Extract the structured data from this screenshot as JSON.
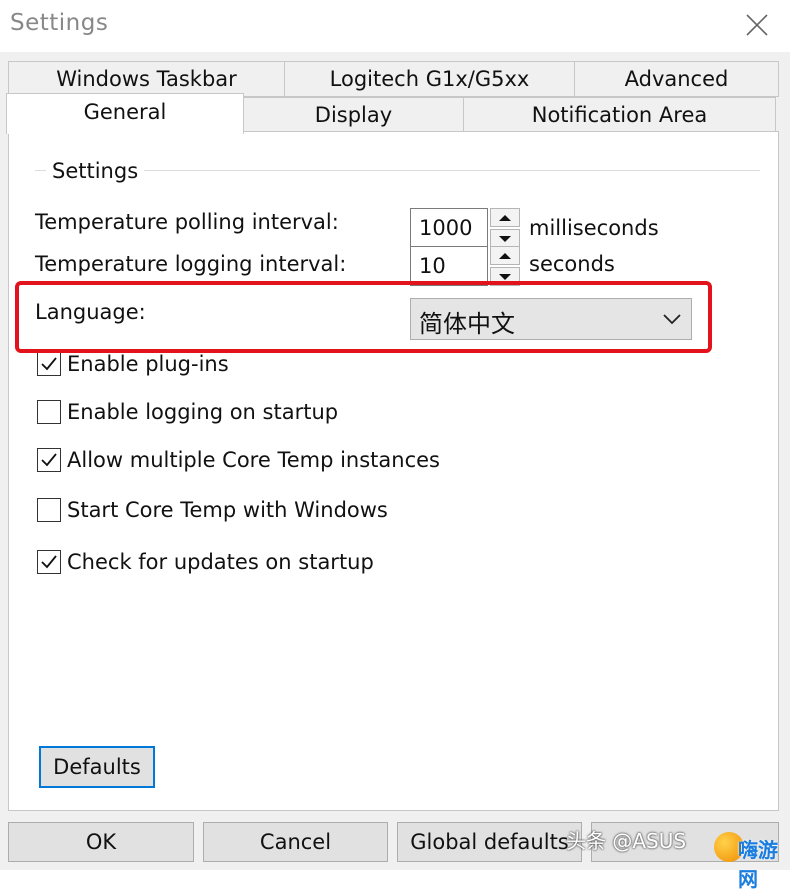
{
  "window": {
    "title": "Settings"
  },
  "tabs": {
    "row1": [
      "Windows Taskbar",
      "Logitech G1x/G5xx",
      "Advanced"
    ],
    "row2": [
      "General",
      "Display",
      "Notification Area"
    ],
    "active": "General"
  },
  "settings": {
    "group_label": "Settings",
    "polling_label": "Temperature polling interval:",
    "polling_value": "1000",
    "polling_unit": "milliseconds",
    "logging_label": "Temperature logging interval:",
    "logging_value": "10",
    "logging_unit": "seconds",
    "language_label": "Language:",
    "language_value": "简体中文",
    "checkboxes": [
      {
        "label": "Enable plug-ins",
        "checked": true
      },
      {
        "label": "Enable logging on startup",
        "checked": false
      },
      {
        "label": "Allow multiple Core Temp instances",
        "checked": true
      },
      {
        "label": "Start Core Temp with Windows",
        "checked": false
      },
      {
        "label": "Check for updates on startup",
        "checked": true
      }
    ]
  },
  "buttons": {
    "defaults": "Defaults",
    "ok": "OK",
    "cancel": "Cancel",
    "global_defaults": "Global defaults"
  },
  "overlay": {
    "watermark": "头条 @ASUS",
    "logo_text": "嗨游网"
  },
  "colors": {
    "highlight": "#e3131b",
    "focus": "#0078d7"
  }
}
